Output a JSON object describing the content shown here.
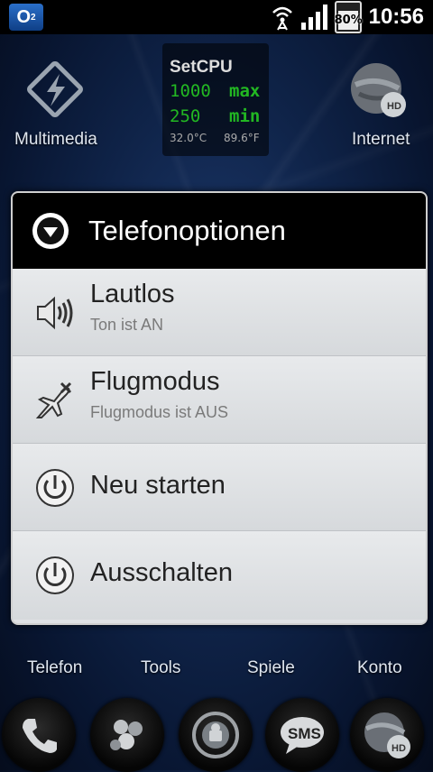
{
  "status_bar": {
    "carrier": "O",
    "carrier_sub": "2",
    "battery_percent": "80%",
    "battery_level": 0.8,
    "time": "10:56",
    "icons": [
      "wifi-icon",
      "signal-icon",
      "battery-icon"
    ]
  },
  "home": {
    "top_icons": [
      {
        "label": "Multimedia",
        "icon": "multimedia-icon"
      },
      {
        "label": "Internet",
        "icon": "internet-icon"
      }
    ],
    "setcpu": {
      "title": "SetCPU",
      "max_value": "1000",
      "max_label": "max",
      "min_value": "250",
      "min_label": "min",
      "temp_c": "32.0°C",
      "temp_f": "89.6°F"
    },
    "bottom_labels": [
      "Telefon",
      "Tools",
      "Spiele",
      "Konto"
    ]
  },
  "dialog": {
    "title": "Telefonoptionen",
    "title_icon": "chevron-down-circle-icon",
    "options": [
      {
        "label": "Lautlos",
        "sub": "Ton ist AN",
        "icon": "speaker-icon"
      },
      {
        "label": "Flugmodus",
        "sub": "Flugmodus ist AUS",
        "icon": "airplane-icon"
      },
      {
        "label": "Neu starten",
        "sub": "",
        "icon": "power-icon"
      },
      {
        "label": "Ausschalten",
        "sub": "",
        "icon": "power-icon"
      }
    ]
  },
  "dock": {
    "items": [
      {
        "icon": "phone-icon"
      },
      {
        "icon": "contacts-icon"
      },
      {
        "icon": "app-drawer-icon"
      },
      {
        "icon": "sms-icon",
        "label": "SMS"
      },
      {
        "icon": "browser-icon",
        "label": "HD"
      }
    ]
  },
  "colors": {
    "setcpu_green": "#22b822",
    "dialog_header": "#000000",
    "dialog_body": "#dfe1e4"
  }
}
